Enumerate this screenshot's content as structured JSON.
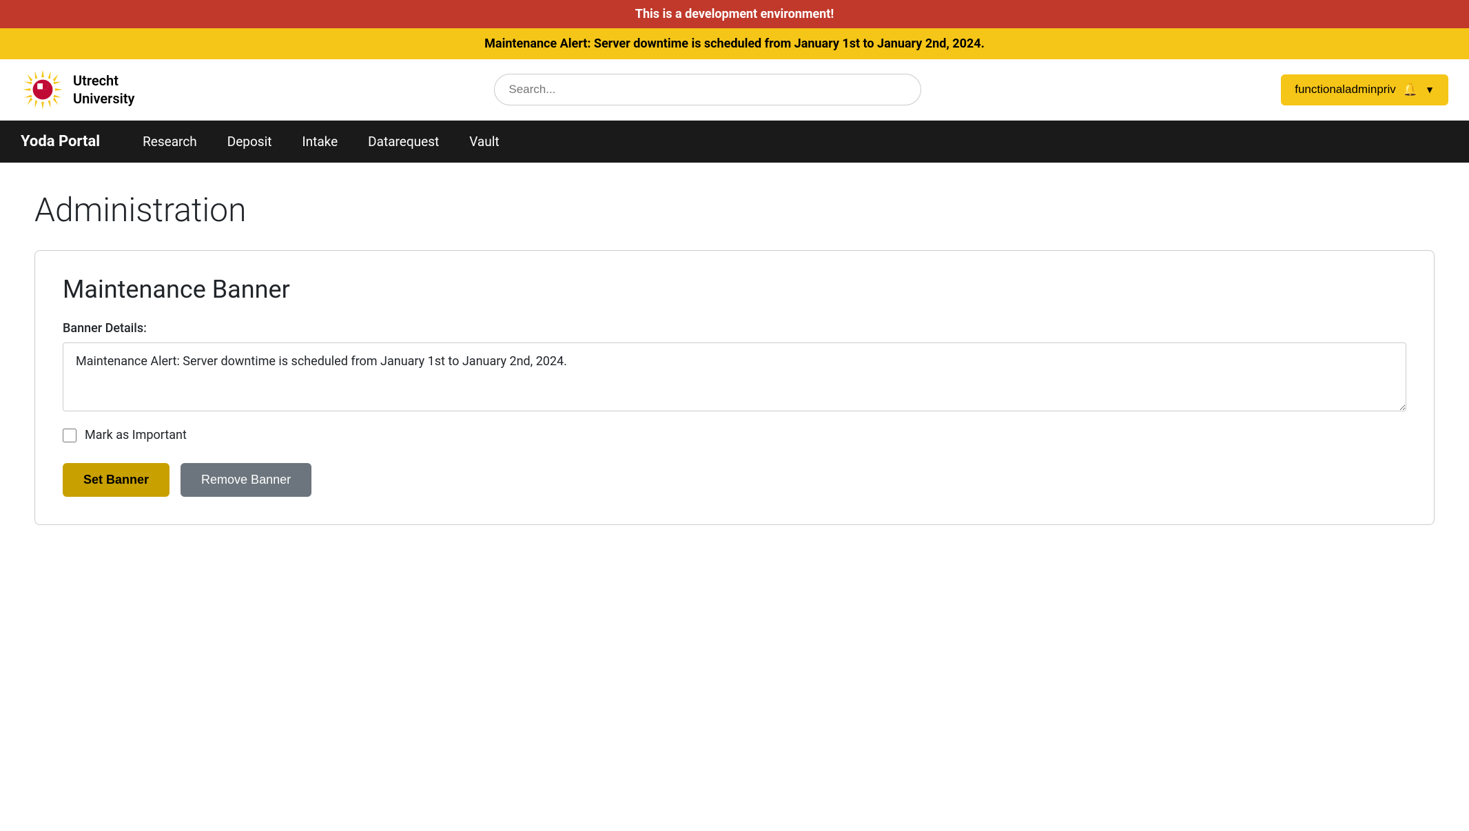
{
  "dev_banner": {
    "text": "This is a development environment!"
  },
  "maintenance_bar": {
    "text": "Maintenance Alert: Server downtime is scheduled from January 1st to January 2nd, 2024."
  },
  "header": {
    "logo_text_line1": "Utrecht",
    "logo_text_line2": "University",
    "search_placeholder": "Search...",
    "user_button_label": "functionaladminpriv"
  },
  "nav": {
    "brand": "Yoda Portal",
    "links": [
      {
        "label": "Research",
        "href": "#"
      },
      {
        "label": "Deposit",
        "href": "#"
      },
      {
        "label": "Intake",
        "href": "#"
      },
      {
        "label": "Datarequest",
        "href": "#"
      },
      {
        "label": "Vault",
        "href": "#"
      }
    ]
  },
  "page": {
    "title": "Administration"
  },
  "maintenance_banner_card": {
    "title": "Maintenance Banner",
    "form_label": "Banner Details:",
    "textarea_value": "Maintenance Alert: Server downtime is scheduled from January 1st to January 2nd, 2024.",
    "checkbox_label": "Mark as Important",
    "set_button_label": "Set Banner",
    "remove_button_label": "Remove Banner"
  },
  "icons": {
    "bell": "🔔",
    "chevron_down": "▼"
  }
}
